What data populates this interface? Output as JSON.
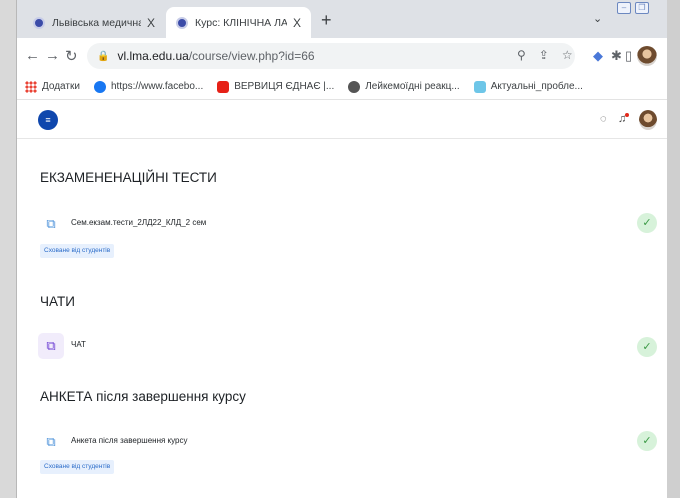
{
  "browser": {
    "tabs": [
      {
        "title": "Львівська медична академія ім",
        "active": false
      },
      {
        "title": "Курс: КЛІНІЧНА ЛАБОРАТОРНА",
        "active": true
      }
    ],
    "close_glyph": "X",
    "new_tab_glyph": "+",
    "url_host": "vl.lma.edu.ua",
    "url_path": "/course/view.php?id=66",
    "bookmarks": [
      {
        "label": "Додатки",
        "icon": "apps-grid-icon"
      },
      {
        "label": "https://www.facebo...",
        "icon": "facebook-icon"
      },
      {
        "label": "ВЕРВИЦЯ ЄДНАЄ |...",
        "icon": "youtube-icon"
      },
      {
        "label": "Лейкемоїдні реакц...",
        "icon": "globe-icon"
      },
      {
        "label": "Актуальні_пробле...",
        "icon": "gem-icon"
      }
    ]
  },
  "moodle": {
    "logo_glyph": "≡"
  },
  "sections": [
    {
      "title": "ЕКЗАМЕНЕНАЦІЙНІ ТЕСТИ",
      "activity": {
        "name": "Сем.екзам.тести_2ЛД22_КЛД_2 сем",
        "type": "quiz"
      },
      "badge": "Сховане від студентів"
    },
    {
      "title": "ЧАТИ",
      "activity": {
        "name": "ЧАТ",
        "type": "chat"
      },
      "badge": ""
    },
    {
      "title": "АНКЕТА після завершення курсу",
      "activity": {
        "name": "Анкета після завершення курсу",
        "type": "quiz"
      },
      "badge": "Сховане від студентів"
    }
  ],
  "colors": {
    "brand": "#0f47ad",
    "completion_green": "#3b9a45",
    "badge_blue": "#2b6cc9"
  }
}
